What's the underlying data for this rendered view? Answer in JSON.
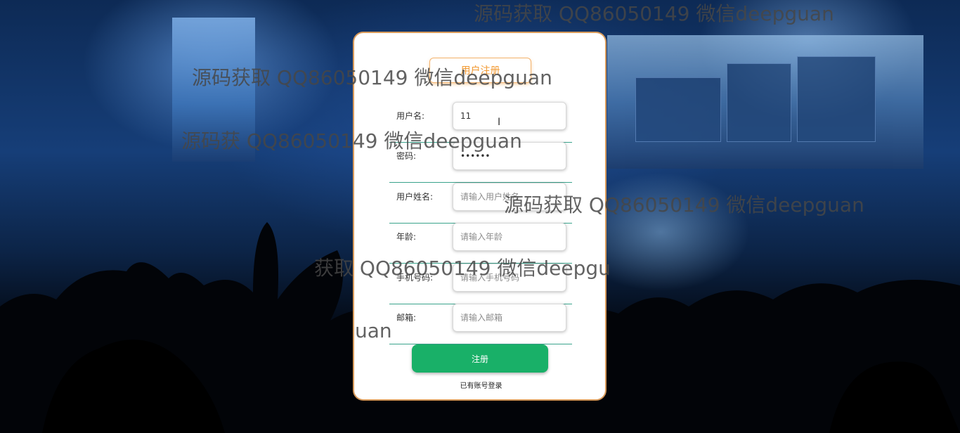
{
  "form": {
    "title": "用户注册",
    "fields": [
      {
        "label": "用户名:",
        "value": "11",
        "placeholder": "",
        "type": "text"
      },
      {
        "label": "密码:",
        "value": "••••••",
        "placeholder": "",
        "type": "password"
      },
      {
        "label": "用户姓名:",
        "value": "",
        "placeholder": "请输入用户姓名",
        "type": "text"
      },
      {
        "label": "年龄:",
        "value": "",
        "placeholder": "请输入年龄",
        "type": "text"
      },
      {
        "label": "手机号码:",
        "value": "",
        "placeholder": "请输入手机号码",
        "type": "text"
      },
      {
        "label": "邮箱:",
        "value": "",
        "placeholder": "请输入邮箱",
        "type": "text"
      }
    ],
    "submit_label": "注册",
    "login_link": "已有账号登录"
  },
  "watermarks": [
    "源码获取 QQ86050149 微信deepguan",
    "源码获取 QQ86050149 微信deepguan",
    "源码获 QQ86050149 微信deepguan",
    "源码获取 QQ86050149 微信deepguan",
    "获取 QQ86050149 微信deepgu",
    "uan"
  ],
  "colors": {
    "accent": "#19b068",
    "title_orange": "#f29a33",
    "card_border": "#d89a5a",
    "row_divider": "#3aa38c"
  },
  "icons": {
    "cursor": "text-cursor-icon"
  }
}
